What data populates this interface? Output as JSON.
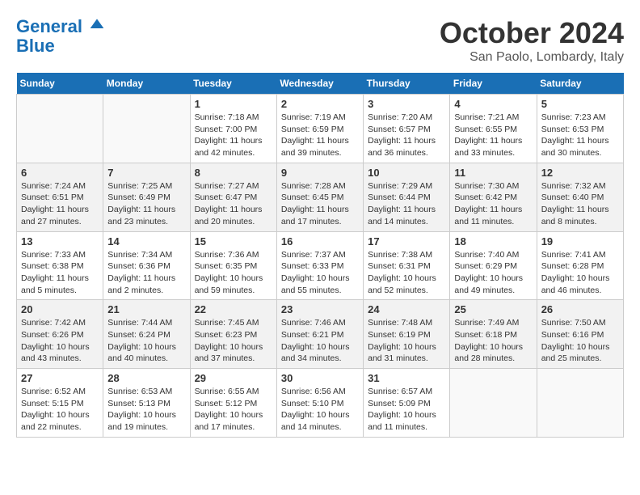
{
  "header": {
    "logo_line1": "General",
    "logo_line2": "Blue",
    "month": "October 2024",
    "location": "San Paolo, Lombardy, Italy"
  },
  "weekdays": [
    "Sunday",
    "Monday",
    "Tuesday",
    "Wednesday",
    "Thursday",
    "Friday",
    "Saturday"
  ],
  "weeks": [
    [
      {
        "day": "",
        "info": ""
      },
      {
        "day": "",
        "info": ""
      },
      {
        "day": "1",
        "info": "Sunrise: 7:18 AM\nSunset: 7:00 PM\nDaylight: 11 hours and 42 minutes."
      },
      {
        "day": "2",
        "info": "Sunrise: 7:19 AM\nSunset: 6:59 PM\nDaylight: 11 hours and 39 minutes."
      },
      {
        "day": "3",
        "info": "Sunrise: 7:20 AM\nSunset: 6:57 PM\nDaylight: 11 hours and 36 minutes."
      },
      {
        "day": "4",
        "info": "Sunrise: 7:21 AM\nSunset: 6:55 PM\nDaylight: 11 hours and 33 minutes."
      },
      {
        "day": "5",
        "info": "Sunrise: 7:23 AM\nSunset: 6:53 PM\nDaylight: 11 hours and 30 minutes."
      }
    ],
    [
      {
        "day": "6",
        "info": "Sunrise: 7:24 AM\nSunset: 6:51 PM\nDaylight: 11 hours and 27 minutes."
      },
      {
        "day": "7",
        "info": "Sunrise: 7:25 AM\nSunset: 6:49 PM\nDaylight: 11 hours and 23 minutes."
      },
      {
        "day": "8",
        "info": "Sunrise: 7:27 AM\nSunset: 6:47 PM\nDaylight: 11 hours and 20 minutes."
      },
      {
        "day": "9",
        "info": "Sunrise: 7:28 AM\nSunset: 6:45 PM\nDaylight: 11 hours and 17 minutes."
      },
      {
        "day": "10",
        "info": "Sunrise: 7:29 AM\nSunset: 6:44 PM\nDaylight: 11 hours and 14 minutes."
      },
      {
        "day": "11",
        "info": "Sunrise: 7:30 AM\nSunset: 6:42 PM\nDaylight: 11 hours and 11 minutes."
      },
      {
        "day": "12",
        "info": "Sunrise: 7:32 AM\nSunset: 6:40 PM\nDaylight: 11 hours and 8 minutes."
      }
    ],
    [
      {
        "day": "13",
        "info": "Sunrise: 7:33 AM\nSunset: 6:38 PM\nDaylight: 11 hours and 5 minutes."
      },
      {
        "day": "14",
        "info": "Sunrise: 7:34 AM\nSunset: 6:36 PM\nDaylight: 11 hours and 2 minutes."
      },
      {
        "day": "15",
        "info": "Sunrise: 7:36 AM\nSunset: 6:35 PM\nDaylight: 10 hours and 59 minutes."
      },
      {
        "day": "16",
        "info": "Sunrise: 7:37 AM\nSunset: 6:33 PM\nDaylight: 10 hours and 55 minutes."
      },
      {
        "day": "17",
        "info": "Sunrise: 7:38 AM\nSunset: 6:31 PM\nDaylight: 10 hours and 52 minutes."
      },
      {
        "day": "18",
        "info": "Sunrise: 7:40 AM\nSunset: 6:29 PM\nDaylight: 10 hours and 49 minutes."
      },
      {
        "day": "19",
        "info": "Sunrise: 7:41 AM\nSunset: 6:28 PM\nDaylight: 10 hours and 46 minutes."
      }
    ],
    [
      {
        "day": "20",
        "info": "Sunrise: 7:42 AM\nSunset: 6:26 PM\nDaylight: 10 hours and 43 minutes."
      },
      {
        "day": "21",
        "info": "Sunrise: 7:44 AM\nSunset: 6:24 PM\nDaylight: 10 hours and 40 minutes."
      },
      {
        "day": "22",
        "info": "Sunrise: 7:45 AM\nSunset: 6:23 PM\nDaylight: 10 hours and 37 minutes."
      },
      {
        "day": "23",
        "info": "Sunrise: 7:46 AM\nSunset: 6:21 PM\nDaylight: 10 hours and 34 minutes."
      },
      {
        "day": "24",
        "info": "Sunrise: 7:48 AM\nSunset: 6:19 PM\nDaylight: 10 hours and 31 minutes."
      },
      {
        "day": "25",
        "info": "Sunrise: 7:49 AM\nSunset: 6:18 PM\nDaylight: 10 hours and 28 minutes."
      },
      {
        "day": "26",
        "info": "Sunrise: 7:50 AM\nSunset: 6:16 PM\nDaylight: 10 hours and 25 minutes."
      }
    ],
    [
      {
        "day": "27",
        "info": "Sunrise: 6:52 AM\nSunset: 5:15 PM\nDaylight: 10 hours and 22 minutes."
      },
      {
        "day": "28",
        "info": "Sunrise: 6:53 AM\nSunset: 5:13 PM\nDaylight: 10 hours and 19 minutes."
      },
      {
        "day": "29",
        "info": "Sunrise: 6:55 AM\nSunset: 5:12 PM\nDaylight: 10 hours and 17 minutes."
      },
      {
        "day": "30",
        "info": "Sunrise: 6:56 AM\nSunset: 5:10 PM\nDaylight: 10 hours and 14 minutes."
      },
      {
        "day": "31",
        "info": "Sunrise: 6:57 AM\nSunset: 5:09 PM\nDaylight: 10 hours and 11 minutes."
      },
      {
        "day": "",
        "info": ""
      },
      {
        "day": "",
        "info": ""
      }
    ]
  ]
}
